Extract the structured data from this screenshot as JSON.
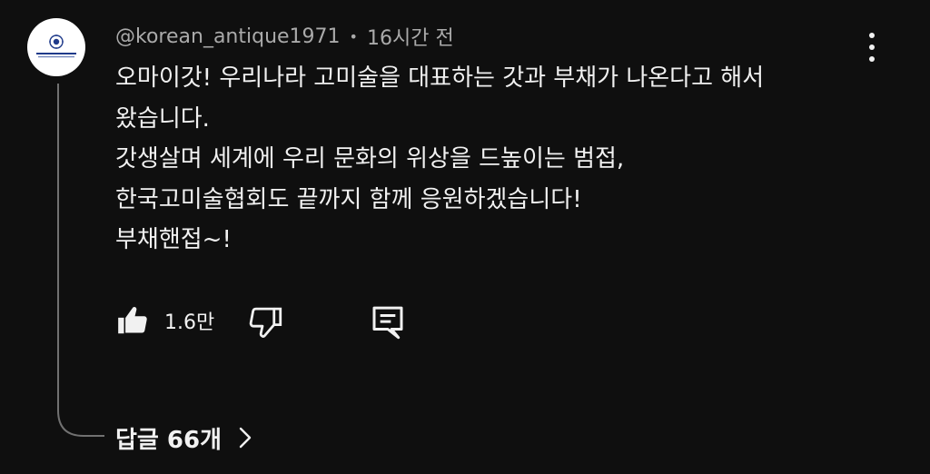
{
  "comment": {
    "author": "@korean_antique1971",
    "separator": "•",
    "time": "16시간 전",
    "avatar_icon": "association-logo-icon",
    "lines": [
      "오마이갓! 우리나라 고미술을 대표하는 갓과 부채가 나온다고 해서",
      "왔습니다.",
      "갓생살며 세계에 우리 문화의 위상을 드높이는 범접,",
      "한국고미술협회도 끝까지 함께 응원하겠습니다!",
      "부채핸접~!"
    ]
  },
  "actions": {
    "like_icon": "thumbs-up-icon",
    "like_count": "1.6만",
    "dislike_icon": "thumbs-down-icon",
    "reply_icon": "comment-reply-icon"
  },
  "replies": {
    "label": "답글 66개",
    "icon": "chevron-right-icon"
  },
  "menu": {
    "icon": "more-vertical-icon"
  }
}
